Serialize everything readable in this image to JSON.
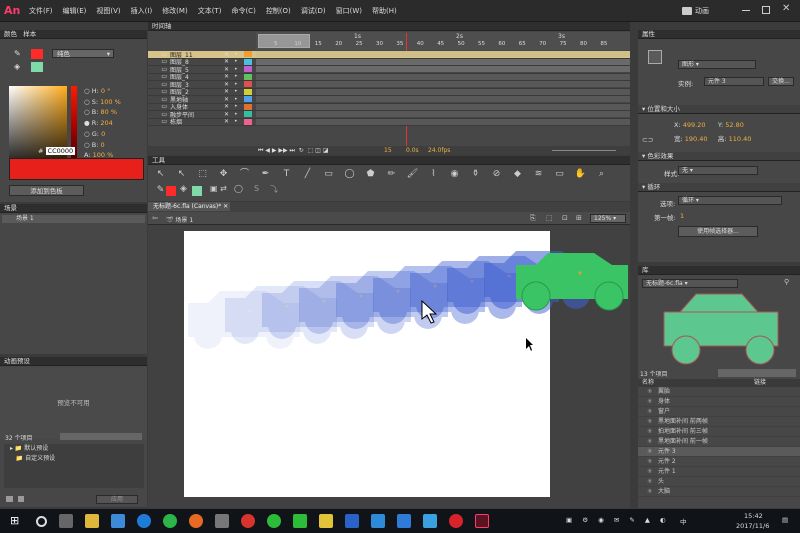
{
  "app": {
    "logo": "An",
    "workspace": "动画"
  },
  "menu": [
    "文件(F)",
    "编辑(E)",
    "视图(V)",
    "插入(I)",
    "修改(M)",
    "文本(T)",
    "命令(C)",
    "控制(O)",
    "调试(D)",
    "窗口(W)",
    "帮助(H)"
  ],
  "color_panel": {
    "tabs": [
      "颜色",
      "样本"
    ],
    "fill_type": "纯色",
    "h_label": "H:",
    "h_value": "0 °",
    "s_label": "S:",
    "s_value": "100 %",
    "b_label": "B:",
    "b_value": "80 %",
    "r_label": "R:",
    "r_value": "204",
    "g_label": "G:",
    "g_value": "0",
    "b2_label": "B:",
    "b2_value": "0",
    "a_label": "A:",
    "a_value": "100 %",
    "hex_label": "#",
    "hex": "CC0000",
    "add_button": "添加到色板",
    "stroke_color": "#ff2a2a",
    "fill_color": "#7fd9a8",
    "swatch": "#e8201c"
  },
  "scene_panel": {
    "title": "场景",
    "item": "场景 1"
  },
  "motion_presets": {
    "title": "动画预设",
    "empty": "预览不可用",
    "count": "32 个项目",
    "items": [
      "默认预设",
      "自定义预设"
    ],
    "apply": "应用"
  },
  "timeline": {
    "title": "时间轴",
    "ruler": [
      "1s",
      "2s",
      "3s"
    ],
    "frame_nums": [
      "5",
      "10",
      "15",
      "20",
      "25",
      "30",
      "35",
      "40",
      "45",
      "50",
      "55",
      "60",
      "65",
      "70",
      "75",
      "80",
      "85"
    ],
    "layers": [
      "图层_11",
      "图层_8",
      "图层_5",
      "图层_4",
      "图层_3",
      "图层_2",
      "黑地轴",
      "入身体",
      "融步平间",
      "栋烟"
    ],
    "current_frame": "15",
    "time": "0.0s",
    "fps": "24.0fps"
  },
  "tools": {
    "title": "工具"
  },
  "document": {
    "tab": "无标题-6c.fla (Canvas)*",
    "scene": "场景 1",
    "zoom": "125%"
  },
  "properties": {
    "title": "属性",
    "type": "图形",
    "instance_label": "实例:",
    "instance_name": "元件 3",
    "swap": "交换...",
    "pos_title": "位置和大小",
    "x_label": "X:",
    "x": "499.20",
    "y_label": "Y:",
    "y": "52.80",
    "w_label": "宽:",
    "w": "190.40",
    "h_label": "高:",
    "h": "110.40",
    "color_title": "色彩效果",
    "style_label": "样式:",
    "style": "无",
    "loop_title": "循环",
    "option_label": "选项:",
    "option": "循环",
    "first_label": "第一帧:",
    "first": "1",
    "edit_button": "使用帧选择器..."
  },
  "library": {
    "title": "库",
    "doc": "无标题-6c.fla",
    "count": "13 个项目",
    "col_name": "名称",
    "col_link": "链接",
    "items": [
      "翼胎",
      "身体",
      "窗户",
      "黑地面补间 前两帧",
      "拍地面补间 前三帧",
      "黑地面补间 前一帧",
      "元件 3",
      "元件 2",
      "元件 1",
      "头",
      "大脑"
    ]
  },
  "taskbar": {
    "time": "15:42",
    "date": "2017/11/6",
    "ime": "中"
  }
}
